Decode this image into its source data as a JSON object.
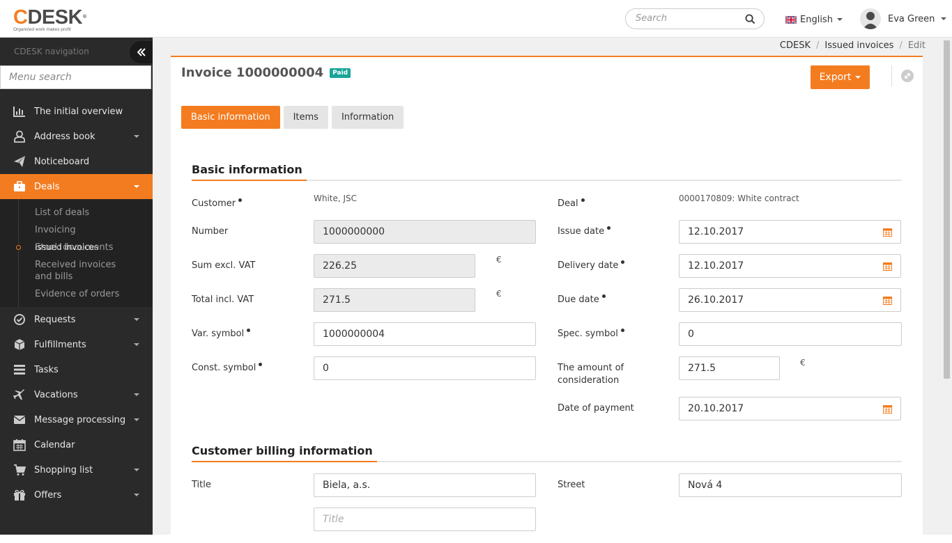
{
  "brand": {
    "logo_text": "CDESK",
    "registered": "®",
    "tagline": "Organized work makes profit"
  },
  "header": {
    "search_placeholder": "Search",
    "language": "English",
    "user_name": "Eva Green"
  },
  "sidebar": {
    "title": "CDESK navigation",
    "menu_search_placeholder": "Menu search",
    "items": [
      {
        "label": "The initial overview",
        "icon": "chart-icon"
      },
      {
        "label": "Address book",
        "icon": "user-icon"
      },
      {
        "label": "Noticeboard",
        "icon": "paper-plane-icon"
      },
      {
        "label": "Deals",
        "icon": "briefcase-icon"
      },
      {
        "label": "Requests",
        "icon": "check-circle-icon"
      },
      {
        "label": "Fulfillments",
        "icon": "box-icon"
      },
      {
        "label": "Tasks",
        "icon": "tasks-icon"
      },
      {
        "label": "Vacations",
        "icon": "plane-icon"
      },
      {
        "label": "Message processing",
        "icon": "envelope-icon"
      },
      {
        "label": "Calendar",
        "icon": "calendar-icon"
      },
      {
        "label": "Shopping list",
        "icon": "cart-icon"
      },
      {
        "label": "Offers",
        "icon": "gift-icon"
      }
    ],
    "deals_submenu": [
      "List of deals",
      "Invoicing",
      "Issued invoices",
      "Stock documents",
      "Received invoices and bills",
      "Evidence of orders"
    ]
  },
  "breadcrumb": [
    "CDESK",
    "Issued invoices",
    "Edit"
  ],
  "page": {
    "title": "Invoice 1000000004",
    "status_badge": "Paid",
    "export_label": "Export",
    "tabs": [
      "Basic information",
      "Items",
      "Information"
    ]
  },
  "basic": {
    "heading": "Basic information",
    "customer_label": "Customer",
    "customer_value": "White, JSC",
    "deal_label": "Deal",
    "deal_value": "0000170809: White contract",
    "number_label": "Number",
    "number_value": "1000000000",
    "issue_date_label": "Issue date",
    "issue_date_value": "12.10.2017",
    "sum_label": "Sum excl. VAT",
    "sum_value": "226.25",
    "delivery_date_label": "Delivery date",
    "delivery_date_value": "12.10.2017",
    "total_label": "Total incl. VAT",
    "total_value": "271.5",
    "due_date_label": "Due date",
    "due_date_value": "26.10.2017",
    "var_symbol_label": "Var. symbol",
    "var_symbol_value": "1000000004",
    "spec_symbol_label": "Spec. symbol",
    "spec_symbol_value": "0",
    "const_symbol_label": "Const. symbol",
    "const_symbol_value": "0",
    "consideration_label": "The amount of consideration",
    "consideration_value": "271.5",
    "payment_date_label": "Date of payment",
    "payment_date_value": "20.10.2017",
    "currency": "€"
  },
  "billing": {
    "heading": "Customer billing information",
    "title_label": "Title",
    "title_value": "Biela, a.s.",
    "title2_placeholder": "Title",
    "street_label": "Street",
    "street_value": "Nová 4"
  },
  "colors": {
    "accent": "#f47c20",
    "sidebar": "#2a2a2a",
    "badge": "#1aa59a"
  }
}
